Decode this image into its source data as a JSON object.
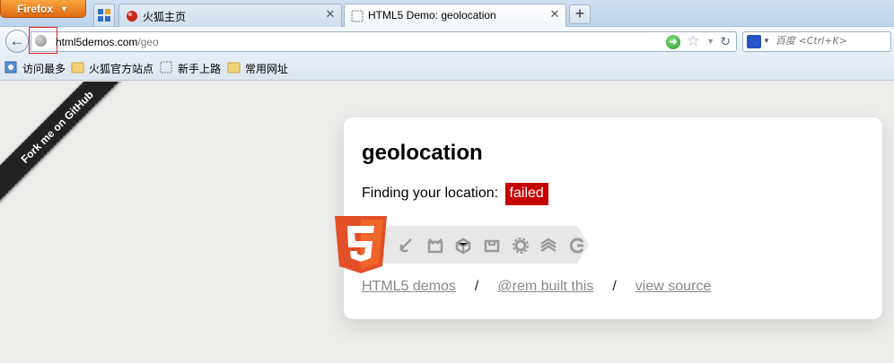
{
  "browser": {
    "menu_button": "Firefox",
    "tabs": [
      {
        "title": "火狐主页",
        "active": false
      },
      {
        "title": "HTML5 Demo: geolocation",
        "active": true
      }
    ],
    "url": {
      "host": "html5demos.com",
      "path": "/geo"
    },
    "search_placeholder": "百度 <Ctrl+K>",
    "bookmarks": [
      {
        "label": "访问最多",
        "icon": "most-visited-icon"
      },
      {
        "label": "火狐官方站点",
        "icon": "folder-icon"
      },
      {
        "label": "新手上路",
        "icon": "page-icon"
      },
      {
        "label": "常用网址",
        "icon": "folder-icon"
      }
    ]
  },
  "page": {
    "ribbon": "Fork me on GitHub",
    "heading": "geolocation",
    "status_label": "Finding your location:",
    "status_value": "failed",
    "status_color": "#c40000",
    "tech_icons": [
      "semantics-icon",
      "offline-icon",
      "device-icon",
      "connectivity-icon",
      "multimedia-icon",
      "performance-icon",
      "css3-icon",
      "storage-icon"
    ],
    "links": [
      "HTML5 demos",
      "@rem built this",
      "view source"
    ],
    "separator": "/"
  }
}
